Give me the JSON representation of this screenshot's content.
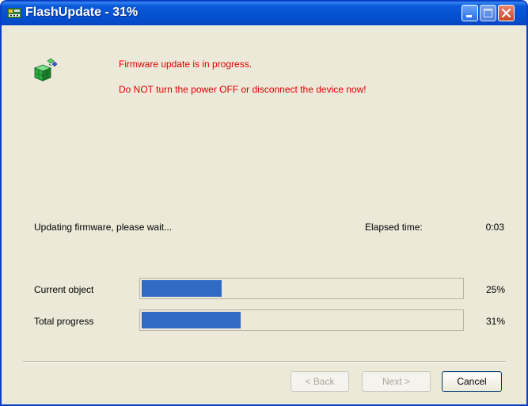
{
  "window": {
    "title": "FlashUpdate - 31%",
    "app_icon": "chip-board-icon",
    "controls": {
      "minimize": "minimize-icon",
      "maximize": "maximize-icon",
      "close": "close-icon"
    }
  },
  "main": {
    "icon": "cube-update-icon",
    "warning_line1": "Firmware update is in progress.",
    "warning_line2": "Do NOT turn the power OFF or disconnect the device now!",
    "warning_color": "#e00000"
  },
  "status": {
    "message": "Updating firmware, please wait...",
    "elapsed_label": "Elapsed time:",
    "elapsed_value": "0:03"
  },
  "progress": {
    "current_label": "Current object",
    "current_percent_text": "25%",
    "current_value": 0.25,
    "total_label": "Total progress",
    "total_percent_text": "31%",
    "total_value": 0.31,
    "bar_color": "#316ac5"
  },
  "buttons": {
    "back": "< Back",
    "next": "Next >",
    "cancel": "Cancel"
  }
}
